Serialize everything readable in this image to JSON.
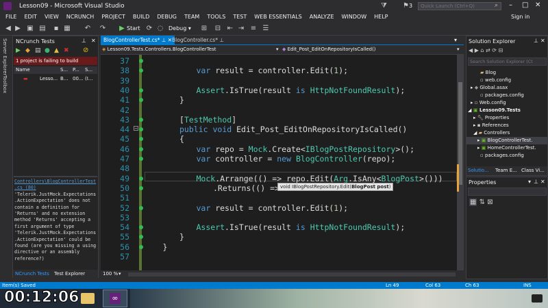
{
  "window": {
    "title": "Lesson09 - Microsoft Visual Studio",
    "notification_count": "3",
    "quick_launch_placeholder": "Quick Launch (Ctrl+Q)",
    "signin": "Sign in"
  },
  "menu": [
    "FILE",
    "EDIT",
    "VIEW",
    "NCRUNCH",
    "PROJECT",
    "BUILD",
    "DEBUG",
    "TEAM",
    "TOOLS",
    "TEST",
    "WEB ESSENTIALS",
    "ANALYZE",
    "WINDOW",
    "HELP"
  ],
  "toolbar": {
    "start_label": "Start",
    "config": "Debug"
  },
  "side_strip": {
    "server_explorer": "Server Explorer",
    "toolbox": "Toolbox"
  },
  "ncrunch": {
    "title": "NCrunch Tests",
    "status": "1 project is failing to build",
    "columns": [
      "Name",
      "S...",
      "P...",
      "S..."
    ],
    "row": [
      "Lesso...",
      "B...",
      "00...",
      "(I..."
    ],
    "message_link": "Controllers\\BlogControllerTest.cs (80)",
    "message": "'Telerik.JustMock.Expectations.ActionExpectation' does not contain a definition for 'Returns' and no extension method 'Returns' accepting a first argument of type 'Telerik.JustMock.Expectations.ActionExpectation' could be found (are you missing a using directive or an assembly reference?)",
    "tabs": [
      "NCrunch Tests",
      "Test Explorer"
    ]
  },
  "editor": {
    "tabs": [
      "BlogControllerTest.cs*",
      "BlogController.cs*"
    ],
    "nav_left": "Lesson09.Tests.Controllers.BlogControllerTest",
    "nav_right": "Edit_Post_EditOnRepositoryIsCalled()",
    "zoom": "100 %",
    "tooltip_prefix": "void IBlogPostRepository.Edit(",
    "tooltip_param": "BlogPost post",
    "tooltip_suffix": ")",
    "lines": [
      {
        "n": "37",
        "t": ""
      },
      {
        "n": "38",
        "t": "var result = controller.Edit(1);"
      },
      {
        "n": "39",
        "t": ""
      },
      {
        "n": "40",
        "t": "Assert.IsTrue(result is HttpNotFoundResult);"
      },
      {
        "n": "41",
        "t": "}"
      },
      {
        "n": "42",
        "t": ""
      },
      {
        "n": "43",
        "t": "[TestMethod]"
      },
      {
        "n": "44",
        "t": "public void Edit_Post_EditOnRepositoryIsCalled()"
      },
      {
        "n": "45",
        "t": "{"
      },
      {
        "n": "46",
        "t": "var repo = Mock.Create<IBlogPostRepository>();"
      },
      {
        "n": "47",
        "t": "var controller = new BlogController(repo);"
      },
      {
        "n": "48",
        "t": ""
      },
      {
        "n": "49",
        "t": "Mock.Arrange(() => repo.Edit(Arg.IsAny<BlogPost>()))"
      },
      {
        "n": "50",
        "t": ".Returns(() =>"
      },
      {
        "n": "51",
        "t": ""
      },
      {
        "n": "52",
        "t": "var result = controller.Edit(1);"
      },
      {
        "n": "53",
        "t": ""
      },
      {
        "n": "54",
        "t": "Assert.IsTrue(result is HttpNotFoundResult);"
      },
      {
        "n": "55",
        "t": "}"
      },
      {
        "n": "56",
        "t": "}"
      },
      {
        "n": "57",
        "t": ""
      }
    ]
  },
  "solution_explorer": {
    "title": "Solution Explorer",
    "search_placeholder": "Search Solution Explorer (Ct",
    "items": [
      "Blog",
      "web.config",
      "Global.asax",
      "packages.config",
      "Web.config",
      "Lesson09.Tests",
      "Properties",
      "References",
      "Controllers",
      "BlogControllerTest.",
      "HomeControllerTest.",
      "packages.config"
    ],
    "tabs": [
      "Solutio...",
      "Team E...",
      "Class Vi..."
    ]
  },
  "properties": {
    "title": "Properties"
  },
  "status": {
    "left": "Item(s) Saved",
    "ln": "Ln 49",
    "col": "Col 63",
    "ch": "Ch 63",
    "mode": "INS"
  },
  "taskbar": {
    "clock": "00:12:06"
  }
}
